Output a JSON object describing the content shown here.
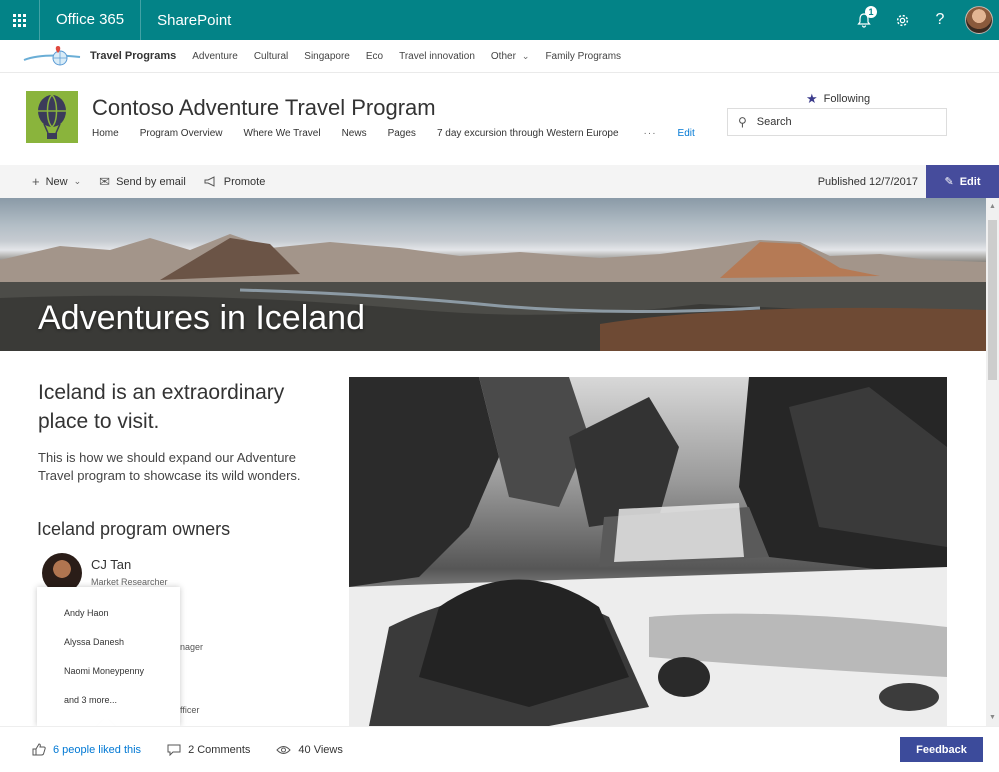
{
  "suite": {
    "app_launcher": "waffle-icon",
    "office_label": "Office 365",
    "app_label": "SharePoint",
    "notification_count": "1",
    "help_label": "?"
  },
  "hub": {
    "title": "Travel Programs",
    "items": [
      "Adventure",
      "Cultural",
      "Singapore",
      "Eco",
      "Travel innovation",
      "Other",
      "Family Programs"
    ]
  },
  "site": {
    "title": "Contoso Adventure Travel Program",
    "nav": [
      "Home",
      "Program Overview",
      "Where We Travel",
      "News",
      "Pages",
      "7 day excursion through Western Europe"
    ],
    "nav_more": "···",
    "nav_edit": "Edit",
    "following_label": "Following",
    "search_placeholder": "Search"
  },
  "command_bar": {
    "new_label": "New",
    "email_label": "Send by email",
    "promote_label": "Promote",
    "published": "Published 12/7/2017",
    "edit_label": "Edit"
  },
  "page": {
    "hero_title": "Adventures in Iceland",
    "intro_heading": "Iceland is an extraordinary place to visit.",
    "intro_body": "This is how we should expand our Adventure Travel program to showcase its wild wonders.",
    "owners_heading": "Iceland program owners",
    "owner": {
      "name": "CJ Tan",
      "role": "Market Researcher"
    },
    "hidden_role_1": "nager",
    "hidden_role_2": "fficer"
  },
  "likes_callout": {
    "people": [
      "Andy Haon",
      "Alyssa Danesh",
      "Naomi Moneypenny",
      "and 3 more..."
    ]
  },
  "footer": {
    "likes": "6 people liked this",
    "comments": "2 Comments",
    "views": "40 Views",
    "feedback": "Feedback"
  },
  "colors": {
    "suite_bar": "#038387",
    "accent": "#464c9c",
    "link": "#0078d4",
    "site_logo": "#8ab43c"
  }
}
